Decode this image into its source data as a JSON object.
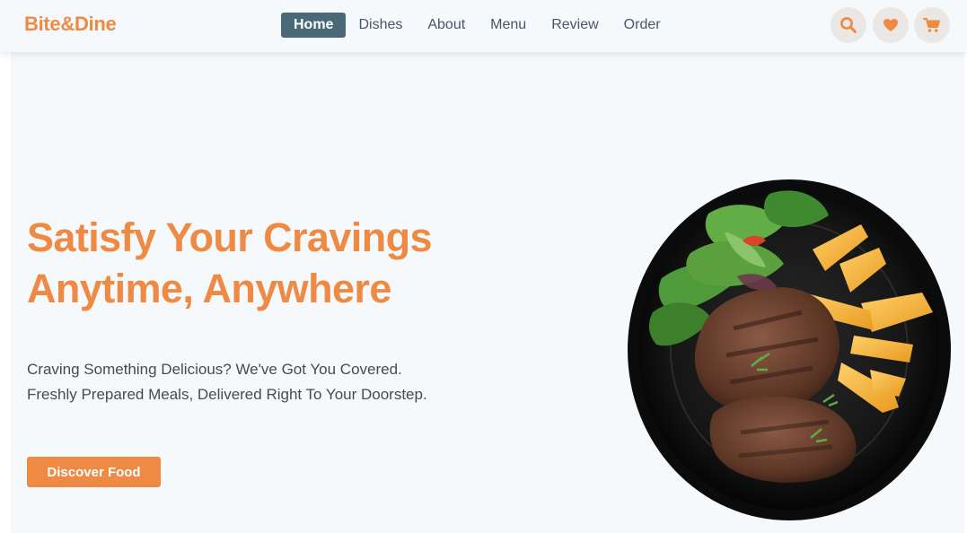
{
  "brand": {
    "name": "Bite&Dine",
    "accent": "#ef8a44"
  },
  "nav": {
    "items": [
      {
        "label": "Home",
        "active": true
      },
      {
        "label": "Dishes",
        "active": false
      },
      {
        "label": "About",
        "active": false
      },
      {
        "label": "Menu",
        "active": false
      },
      {
        "label": "Review",
        "active": false
      },
      {
        "label": "Order",
        "active": false
      }
    ],
    "active_color": "#4a6978"
  },
  "header_icons": [
    "search-icon",
    "heart-icon",
    "cart-icon"
  ],
  "hero": {
    "headline_line1": "Satisfy Your Cravings",
    "headline_line2": "Anytime, Anywhere",
    "sub_line1": "Craving Something Delicious? We've Got You Covered.",
    "sub_line2": "Freshly Prepared Meals, Delivered Right To Your Doorstep.",
    "cta_label": "Discover Food",
    "image": "steak-potato-wedges-salad-plate"
  }
}
